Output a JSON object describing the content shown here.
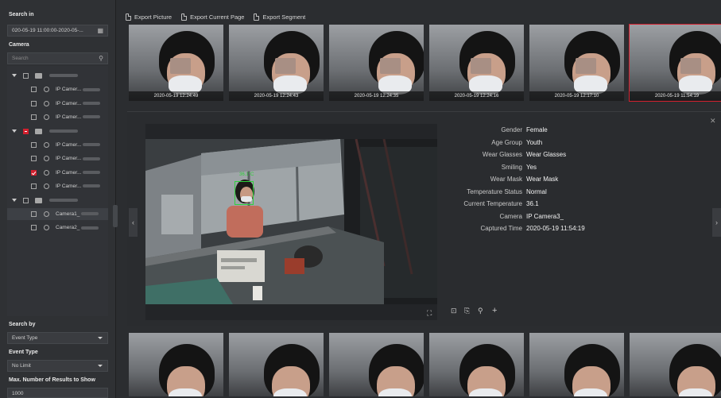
{
  "left": {
    "search_in_label": "Search in",
    "time_range": "020-05-19 11:00:00-2020-05-...",
    "camera_label": "Camera",
    "search_placeholder": "Search",
    "search_by_label": "Search by",
    "search_by_value": "Event Type",
    "event_type_label": "Event Type",
    "event_type_value": "No Limit",
    "max_results_label": "Max. Number of Results to Show",
    "max_results_value": "1000",
    "tree": [
      {
        "type": "server",
        "label": "",
        "expanded": true,
        "state": "off"
      },
      {
        "type": "camera",
        "label": "IP Camer...",
        "state": "off"
      },
      {
        "type": "camera",
        "label": "IP Camer...",
        "state": "off"
      },
      {
        "type": "camera",
        "label": "IP Camer...",
        "state": "off"
      },
      {
        "type": "server",
        "label": "",
        "expanded": true,
        "state": "partial"
      },
      {
        "type": "camera",
        "label": "IP Camer...",
        "state": "off"
      },
      {
        "type": "camera",
        "label": "IP Camer...",
        "state": "off"
      },
      {
        "type": "camera",
        "label": "IP Camer...",
        "state": "on"
      },
      {
        "type": "camera",
        "label": "IP Camer...",
        "state": "off"
      },
      {
        "type": "server",
        "label": "",
        "expanded": true,
        "state": "off"
      },
      {
        "type": "camera",
        "label": "Camera1_",
        "state": "off",
        "selected": true
      },
      {
        "type": "camera",
        "label": "Camera2_",
        "state": "off"
      }
    ]
  },
  "toolbar": {
    "export_picture": "Export Picture",
    "export_current_page": "Export Current Page",
    "export_segment": "Export Segment"
  },
  "thumbnails_top": [
    {
      "timestamp": "2020-05-19 12:24:49"
    },
    {
      "timestamp": "2020-05-19 12:24:43"
    },
    {
      "timestamp": "2020-05-19 12:24:35"
    },
    {
      "timestamp": "2020-05-19 12:24:16"
    },
    {
      "timestamp": "2020-05-19 12:17:10"
    },
    {
      "timestamp": "2020-05-19 11:54:19",
      "selected": true
    }
  ],
  "thumbnails_bottom": [
    {
      "timestamp": ""
    },
    {
      "timestamp": ""
    },
    {
      "timestamp": ""
    },
    {
      "timestamp": ""
    },
    {
      "timestamp": ""
    },
    {
      "timestamp": ""
    }
  ],
  "detail": {
    "face_label": "36.1°C",
    "fields": [
      {
        "key": "Gender",
        "value": "Female"
      },
      {
        "key": "Age Group",
        "value": "Youth"
      },
      {
        "key": "Wear Glasses",
        "value": "Wear Glasses"
      },
      {
        "key": "Smiling",
        "value": "Yes"
      },
      {
        "key": "Wear Mask",
        "value": "Wear Mask"
      },
      {
        "key": "Temperature Status",
        "value": "Normal"
      },
      {
        "key": "Current Temperature",
        "value": "36.1"
      },
      {
        "key": "Camera",
        "value": "IP Camera3_"
      },
      {
        "key": "Captured Time",
        "value": "2020-05-19 11:54:19"
      }
    ],
    "close_glyph": "✕",
    "prev_glyph": "‹",
    "next_glyph": "›"
  },
  "colors": {
    "accent": "#d2202e",
    "face_box": "#2fd13b",
    "panel_bg": "#2f3134",
    "background": "#2b2d30"
  }
}
